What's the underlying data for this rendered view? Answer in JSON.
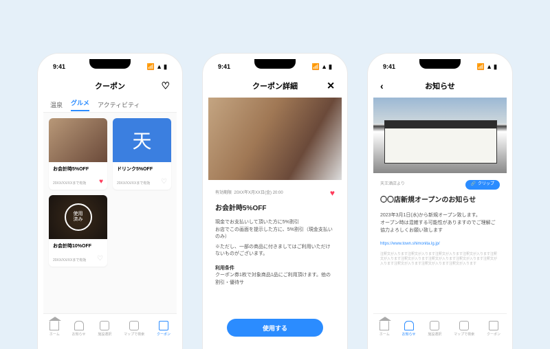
{
  "status_time": "9:41",
  "phone1": {
    "title": "クーポン",
    "tabs": [
      "温泉",
      "グルメ",
      "アクティビティ"
    ],
    "active_tab_index": 1,
    "cards": [
      {
        "title": "お会計時5%OFF",
        "validity": "20XX/XX/XXまで有効",
        "fav": true
      },
      {
        "title": "ドリンク5%OFF",
        "validity": "20XX/XX/XXまで有効",
        "blue_char": "天",
        "fav": false
      },
      {
        "title": "お会計時10%OFF",
        "validity": "20XX/XX/XXまで有効",
        "used_label": "使用\n済み",
        "fav": false
      }
    ],
    "tabbar_active": 4
  },
  "phone2": {
    "title": "クーポン詳細",
    "validity_label": "有効期限",
    "validity_value": "20XX年X月XX日(金) 20:00",
    "coupon_title": "お会計時5%OFF",
    "desc1": "現金でお支払いして頂いた方に5%割引",
    "desc2": "お店でこの画面を提示した方に、5%割引（現金支払いのみ）",
    "desc3": "※ただし、一部の商品に付きましてはご利用いただけないものがございます。",
    "terms_label": "利用条件",
    "terms_text": "クーポン券1枚で対象商品1品にご利用頂けます。他の割引・優待サ",
    "use_button": "使用する"
  },
  "phone3": {
    "title": "お知らせ",
    "source": "天王酒店より",
    "clip_label": "クリップ",
    "news_title": "〇〇店新規オープンのお知らせ",
    "body1": "2023年3月1日(水)から新規オープン致します。",
    "body2": "オープン時は混雑する可能性がありますのでご理解ご協力よろしくお願い致します",
    "link": "https://www.town.shimonita.lg.jp/",
    "filler": "注釈文が入ります注釈文が入ります注釈文が入ります注釈文が入ります注釈文が入ります注釈文が入ります注釈文が入ります注釈文が入ります注釈文が入ります注釈文が入ります注釈文が入ります注釈文が入ります",
    "tabbar_active": 1
  },
  "tabbar_labels": [
    "ホーム",
    "お知らせ",
    "施設選択",
    "マップで検索",
    "クーポン"
  ]
}
